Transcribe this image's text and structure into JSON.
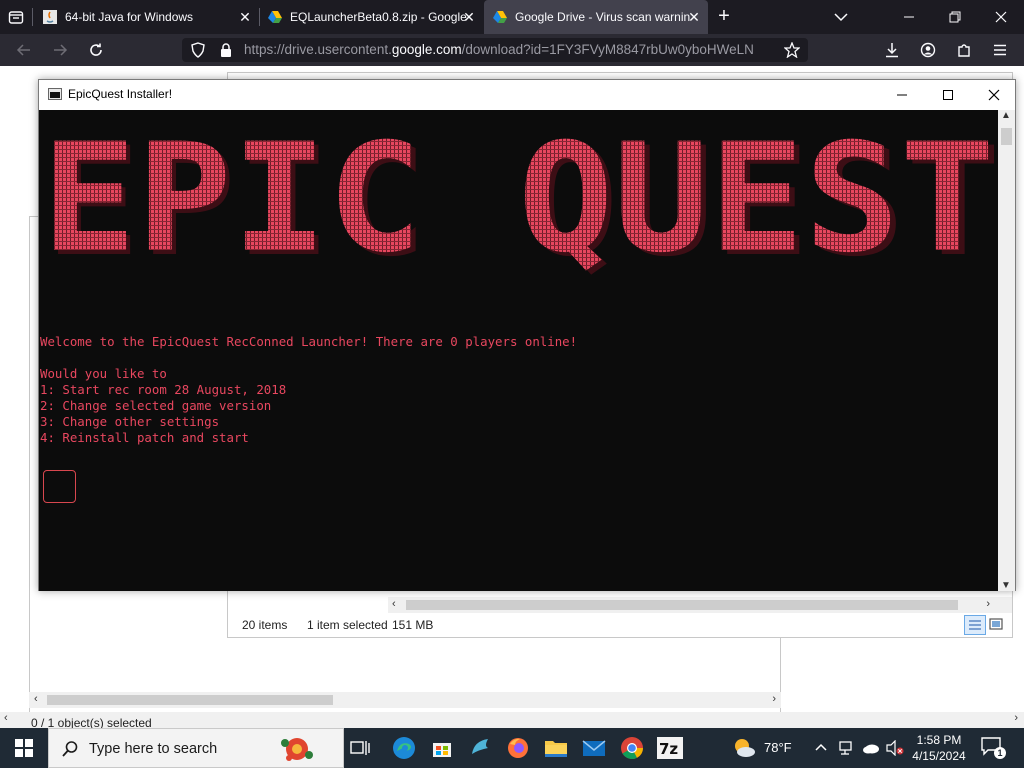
{
  "browser": {
    "tabs": [
      {
        "title": "64-bit Java for Windows",
        "icon": "java-icon"
      },
      {
        "title": "EQLauncherBeta0.8.zip - Google",
        "icon": "google-drive-icon"
      },
      {
        "title": "Google Drive - Virus scan warnin",
        "icon": "google-drive-icon",
        "active": true
      }
    ],
    "url": {
      "prefix": "https://drive.usercontent.",
      "domain": "google.com",
      "path": "/download?id=1FY3FVyM8847rbUw0yboHWeLN"
    }
  },
  "console_window": {
    "title": "EpicQuest Installer!",
    "banner_text": "EPIC QUEST",
    "lines": [
      "Welcome to the EpicQuest RecConned Launcher! There are 0 players online!",
      "",
      "Would you like to",
      "1: Start rec room 28 August, 2018",
      "2: Change selected game version",
      "3: Change other settings",
      "4: Reinstall patch and start"
    ]
  },
  "explorer_right": {
    "status_items": "20 items",
    "status_selected": "1 item selected",
    "status_size": "151 MB"
  },
  "explorer_left": {
    "status": "0 / 1 object(s) selected"
  },
  "taskbar": {
    "search_placeholder": "Type here to search",
    "weather_temp": "78°F",
    "time": "1:58 PM",
    "date": "4/15/2024",
    "notification_badge": "1"
  },
  "colors": {
    "console_text": "#e8475f",
    "console_bg": "#0c0c0c",
    "browser_tabbar": "#1c1b22",
    "taskbar": "#1f2a35"
  }
}
